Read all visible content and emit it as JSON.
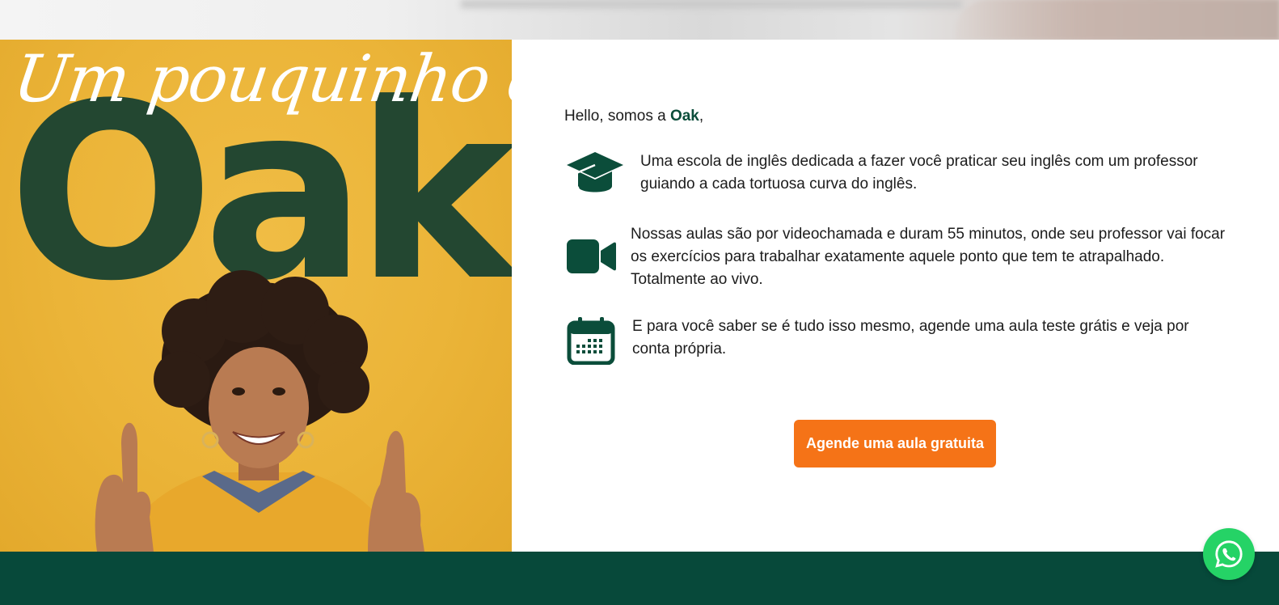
{
  "hero": {
    "script_text": "Um pouquinho da",
    "big_word": "Oak"
  },
  "intro": {
    "greeting_prefix": "Hello, somos a ",
    "brand": "Oak",
    "greeting_suffix": ","
  },
  "features": [
    {
      "icon": "graduation-cap-icon",
      "text": "Uma escola de inglês dedicada a fazer você praticar seu inglês com um professor guiando a cada tortuosa curva do inglês."
    },
    {
      "icon": "video-camera-icon",
      "text": "Nossas aulas são por videochamada e duram 55 minutos, onde seu professor vai focar os exercícios para trabalhar exatamente aquele ponto que tem te atrapalhado. Totalmente ao vivo."
    },
    {
      "icon": "calendar-icon",
      "text": "E para você saber se é tudo isso mesmo, agende uma aula teste grátis e veja por conta própria."
    }
  ],
  "cta": {
    "label": "Agende uma aula gratuita"
  },
  "floating": {
    "icon": "whatsapp-icon"
  },
  "colors": {
    "brand_green": "#0b4d3a",
    "footer_green": "#07493a",
    "hero_yellow": "#ebb438",
    "cta_orange": "#f57317",
    "whatsapp_green": "#25d366"
  }
}
